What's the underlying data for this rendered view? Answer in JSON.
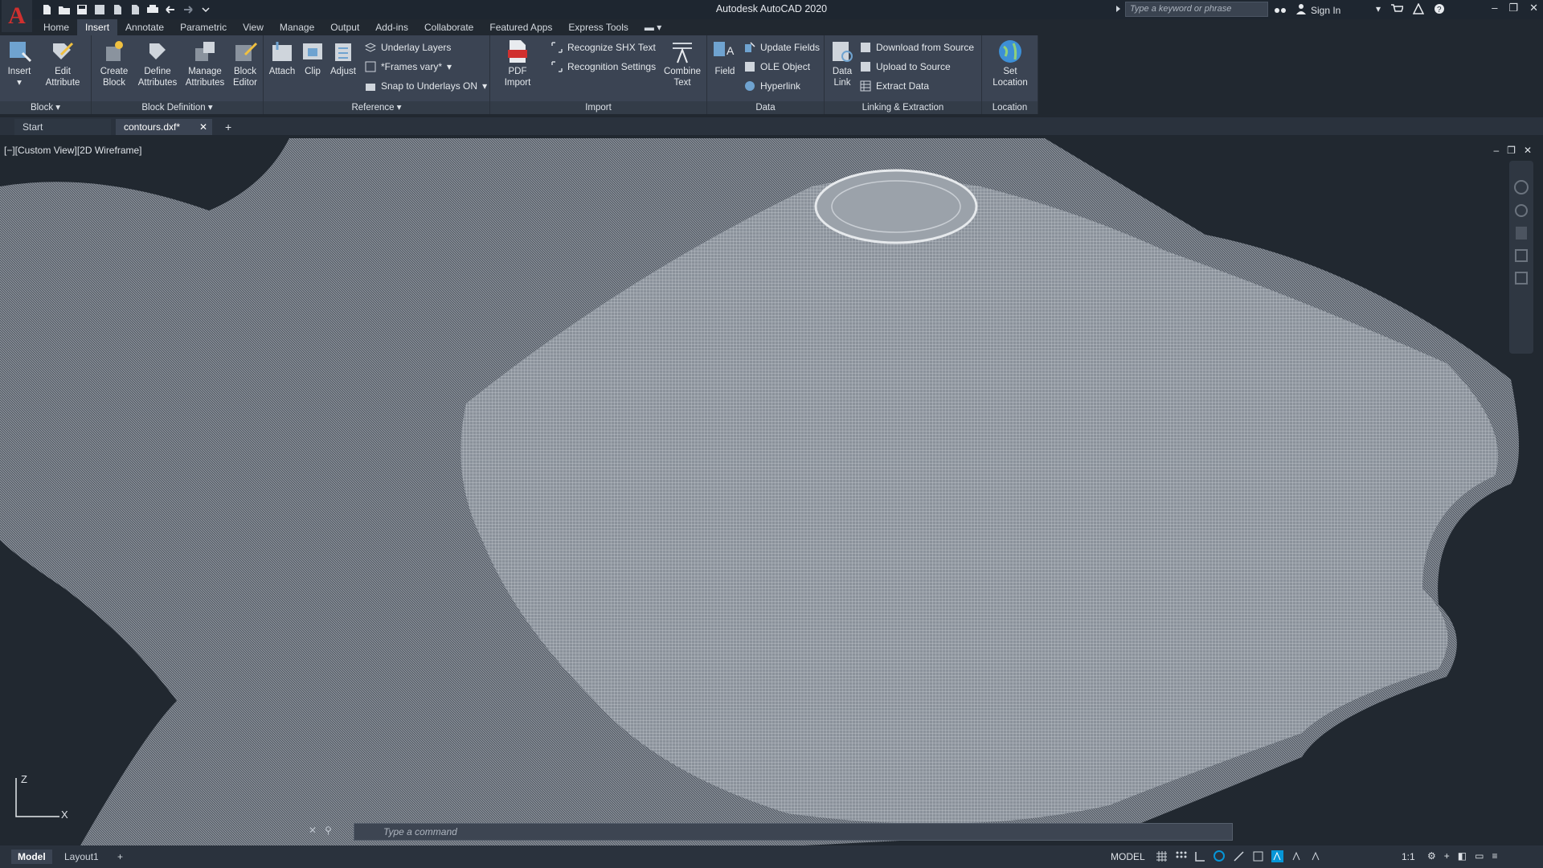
{
  "titlebar": {
    "title": "Autodesk AutoCAD 2020",
    "search_placeholder": "Type a keyword or phrase",
    "signin_label": "Sign In"
  },
  "ribbon_tabs": [
    "Home",
    "Insert",
    "Annotate",
    "Parametric",
    "View",
    "Manage",
    "Output",
    "Add-ins",
    "Collaborate",
    "Featured Apps",
    "Express Tools"
  ],
  "ribbon": {
    "block": {
      "title": "Block",
      "insert": "Insert",
      "edit_attribute_1": "Edit",
      "edit_attribute_2": "Attribute"
    },
    "block_definition": {
      "title": "Block Definition",
      "create_1": "Create",
      "create_2": "Block",
      "define_1": "Define",
      "define_2": "Attributes",
      "manage_1": "Manage",
      "manage_2": "Attributes",
      "editor_1": "Block",
      "editor_2": "Editor"
    },
    "reference": {
      "title": "Reference",
      "attach": "Attach",
      "clip": "Clip",
      "adjust": "Adjust",
      "underlay_layers": "Underlay Layers",
      "frames_vary": "*Frames vary*",
      "snap_underlays": "Snap to Underlays ON"
    },
    "import": {
      "title": "Import",
      "pdf_1": "PDF",
      "pdf_2": "Import",
      "recognize_shx": "Recognize SHX Text",
      "recognition_settings": "Recognition Settings",
      "combine_1": "Combine",
      "combine_2": "Text"
    },
    "data": {
      "title": "Data",
      "field": "Field",
      "update_fields": "Update Fields",
      "ole_object": "OLE Object",
      "hyperlink": "Hyperlink"
    },
    "linking": {
      "title": "Linking & Extraction",
      "data_link_1": "Data",
      "data_link_2": "Link",
      "download": "Download from Source",
      "upload": "Upload to Source",
      "extract": "Extract  Data"
    },
    "location": {
      "title": "Location",
      "set_1": "Set",
      "set_2": "Location"
    }
  },
  "doc_tabs": {
    "start": "Start",
    "contours": "contours.dxf*"
  },
  "viewport": {
    "label": "[−][Custom View][2D Wireframe]",
    "ucs_z": "Z",
    "ucs_x": "X"
  },
  "command": {
    "placeholder": "Type  a  command"
  },
  "statusbar": {
    "model_tab": "Model",
    "layout_tab": "Layout1",
    "add": "+",
    "model_space": "MODEL",
    "scale": "1:1"
  },
  "colors": {
    "background": "#212830",
    "ribbon": "#3b4453",
    "accent": "#0696d7",
    "logo": "#d0302f"
  }
}
